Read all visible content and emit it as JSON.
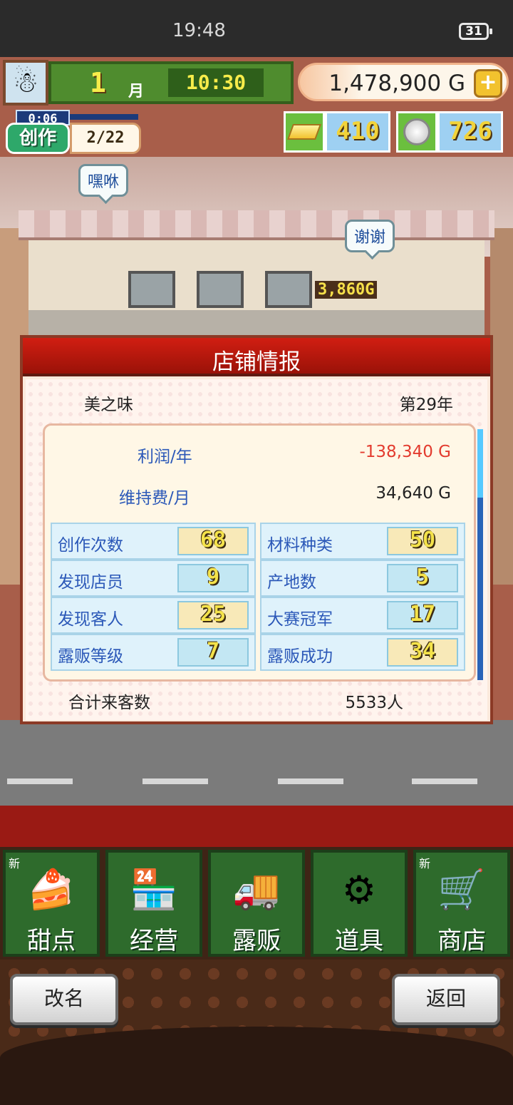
{
  "status_bar": {
    "time": "19:48",
    "battery": "31"
  },
  "hud": {
    "month": "1",
    "month_unit": "月",
    "clock": "10:30",
    "money": "1,478,900 G",
    "create": {
      "timer": "0:06",
      "label": "创作",
      "count": "2/22"
    },
    "gold_bars": "410",
    "medals": "726"
  },
  "scene": {
    "bubble_left": "嘿咻",
    "bubble_right": "谢谢",
    "earned": "3,860G"
  },
  "dialog": {
    "title": "店铺情报",
    "shop_name": "美之味",
    "year": "第29年",
    "profit_label": "利润/年",
    "profit_value": "-138,340 G",
    "upkeep_label": "维持费/月",
    "upkeep_value": "34,640 G",
    "stats": [
      {
        "label": "创作次数",
        "value": "68"
      },
      {
        "label": "材料种类",
        "value": "50"
      },
      {
        "label": "发现店员",
        "value": "9"
      },
      {
        "label": "产地数",
        "value": "5"
      },
      {
        "label": "发现客人",
        "value": "25"
      },
      {
        "label": "大赛冠军",
        "value": "17"
      },
      {
        "label": "露贩等级",
        "value": "7"
      },
      {
        "label": "露贩成功",
        "value": "34"
      }
    ],
    "total_label": "合计来客数",
    "total_value": "5533人"
  },
  "menu": {
    "items": [
      {
        "label": "甜点",
        "icon": "cake-icon",
        "new": "新"
      },
      {
        "label": "经营",
        "icon": "shop-icon",
        "new": ""
      },
      {
        "label": "露贩",
        "icon": "food-truck-icon",
        "new": ""
      },
      {
        "label": "道具",
        "icon": "items-icon",
        "new": ""
      },
      {
        "label": "商店",
        "icon": "cart-icon",
        "new": "新"
      }
    ]
  },
  "buttons": {
    "rename": "改名",
    "back": "返回"
  },
  "colors": {
    "header_red": "#c0190e",
    "label_blue": "#2b58b8",
    "negative_red": "#e33b2e",
    "menu_green": "#2e6b2c"
  }
}
